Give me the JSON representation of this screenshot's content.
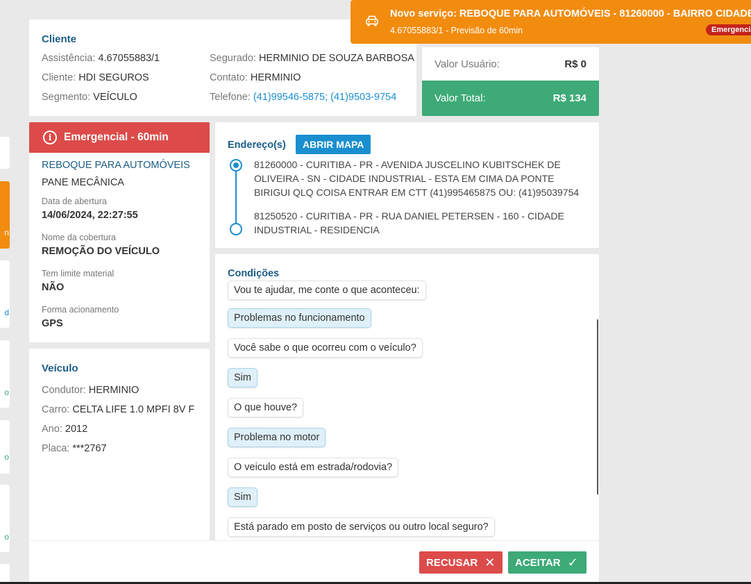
{
  "notification": {
    "title": "Novo serviço: REBOQUE PARA AUTOMÓVEIS - 81260000 - BAIRRO CIDADE IND",
    "subtitle": "4.67055883/1 - Previsão de 60min",
    "badge": "Emergencia",
    "icon": "car-icon",
    "color": "#f28c0f"
  },
  "left_stubs": {
    "stub2_text": "n",
    "stub3_text": "d",
    "stub4_text": "o",
    "stub5_text": "o",
    "stub6_text": "o"
  },
  "cliente": {
    "title": "Cliente",
    "assistencia_label": "Assistência:",
    "assistencia": "4.67055883/1",
    "cliente_label": "Cliente:",
    "cliente": "HDI SEGUROS",
    "segmento_label": "Segmento:",
    "segmento": "VEÍCULO",
    "segurado_label": "Segurado:",
    "segurado": "HERMINIO DE SOUZA BARBOSA",
    "contato_label": "Contato:",
    "contato": "HERMINIO",
    "telefone_label": "Telefone:",
    "telefone": "(41)99546-5875; (41)9503-9754"
  },
  "valores": {
    "usuario_label": "Valor Usuário:",
    "usuario": "R$ 0",
    "total_label": "Valor Total:",
    "total": "R$ 134",
    "total_color": "#3daa77"
  },
  "servico": {
    "header": "Emergencial - 60min",
    "header_color": "#dc4b49",
    "tipo": "REBOQUE PARA AUTOMÓVEIS",
    "motivo": "PANE MECÂNICA",
    "data_label": "Data de abertura",
    "data": "14/06/2024, 22:27:55",
    "cobertura_label": "Nome da cobertura",
    "cobertura": "REMOÇÃO DO VEÍCULO",
    "limite_label": "Tem limite material",
    "limite": "NÃO",
    "forma_label": "Forma acionamento",
    "forma": "GPS"
  },
  "veiculo": {
    "title": "Veículo",
    "condutor_label": "Condutor:",
    "condutor": "HERMINIO",
    "carro_label": "Carro:",
    "carro": "CELTA LIFE 1.0 MPFI 8V F",
    "ano_label": "Ano:",
    "ano": "2012",
    "placa_label": "Placa:",
    "placa": "***2767"
  },
  "endereco": {
    "title": "Endereço(s)",
    "map_button": "ABRIR MAPA",
    "origem": "81260000 - CURITIBA - PR - AVENIDA JUSCELINO KUBITSCHEK DE OLIVEIRA - SN - CIDADE INDUSTRIAL - ESTA EM CIMA DA PONTE BIRIGUI QLQ COISA ENTRAR EM CTT (41)995465875 OU: (41)95039754",
    "destino": "81250520 - CURITIBA - PR - RUA DANIEL PETERSEN - 160 - CIDADE INDUSTRIAL - RESIDENCIA"
  },
  "condicoes": {
    "title": "Condições",
    "messages": [
      {
        "text": "Vou te ajudar, me conte o que aconteceu:",
        "from": "bot"
      },
      {
        "text": "Problemas no funcionamento",
        "from": "user"
      },
      {
        "text": "Você sabe o que ocorreu com o veículo?",
        "from": "bot"
      },
      {
        "text": "Sim",
        "from": "user"
      },
      {
        "text": "O que houve?",
        "from": "bot"
      },
      {
        "text": "Problema no motor",
        "from": "user"
      },
      {
        "text": "O veiculo está em estrada/rodovia?",
        "from": "bot"
      },
      {
        "text": "Sim",
        "from": "user"
      },
      {
        "text": "Está parado em posto de serviços ou outro local seguro?",
        "from": "bot"
      }
    ]
  },
  "footer": {
    "recusar": "RECUSAR",
    "aceitar": "ACEITAR"
  }
}
